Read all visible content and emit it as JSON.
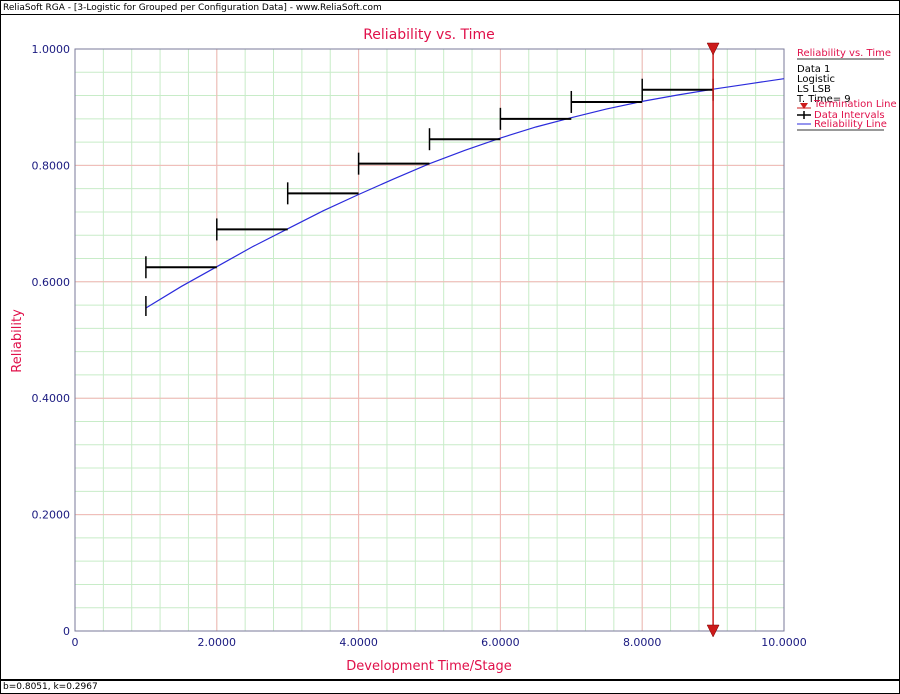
{
  "window": {
    "title": "ReliaSoft RGA - [3-Logistic for Grouped per Configuration Data] - www.ReliaSoft.com",
    "status": "b=0.8051, k=0.2967"
  },
  "legend": {
    "title": "Reliability vs. Time",
    "info": [
      "Data 1",
      "Logistic",
      "LS LSB",
      "T. Time= 9"
    ],
    "entries": [
      "Termination Line",
      "Data Intervals",
      "Reliability Line"
    ]
  },
  "colors": {
    "title": "#e0104a",
    "ticks": "#1a1a80",
    "major_grid": "#f4b6b6",
    "minor_grid": "#c8ecc8",
    "reliability_line": "#2b2bdc",
    "termination_line": "#cc1a1a",
    "data_intervals": "#000000"
  },
  "chart_data": {
    "type": "line",
    "title": "Reliability vs. Time",
    "xlabel": "Development Time/Stage",
    "ylabel": "Reliability",
    "xlim": [
      0,
      10
    ],
    "ylim": [
      0,
      1
    ],
    "x_ticks": [
      0,
      2,
      4,
      6,
      8,
      10
    ],
    "x_tick_labels": [
      "0",
      "2.0000",
      "4.0000",
      "6.0000",
      "8.0000",
      "10.0000"
    ],
    "y_ticks": [
      0,
      0.2,
      0.4,
      0.6,
      0.8,
      1.0
    ],
    "y_tick_labels": [
      "0",
      "0.2000",
      "0.4000",
      "0.6000",
      "0.8000",
      "1.0000"
    ],
    "grid": true,
    "legend_position": "top-right",
    "model": {
      "b": 0.8051,
      "k": 0.2967
    },
    "series": [
      {
        "name": "Reliability Line",
        "type": "line",
        "x": [
          1,
          1.5,
          2,
          2.5,
          3,
          3.5,
          4,
          4.5,
          5,
          5.5,
          6,
          6.5,
          7,
          7.5,
          8,
          8.5,
          9,
          9.5,
          10
        ],
        "y": [
          0.555,
          0.592,
          0.626,
          0.66,
          0.691,
          0.722,
          0.75,
          0.777,
          0.803,
          0.826,
          0.847,
          0.866,
          0.882,
          0.897,
          0.91,
          0.921,
          0.931,
          0.94,
          0.949
        ]
      },
      {
        "name": "Data Intervals",
        "type": "interval",
        "start": [
          1,
          2,
          3,
          4,
          5,
          6,
          7,
          8
        ],
        "end": [
          2,
          3,
          4,
          5,
          6,
          7,
          8,
          9
        ],
        "y": [
          0.625,
          0.69,
          0.752,
          0.803,
          0.845,
          0.88,
          0.909,
          0.93
        ]
      },
      {
        "name": "Termination Line",
        "type": "vertical",
        "x": 9
      }
    ]
  }
}
